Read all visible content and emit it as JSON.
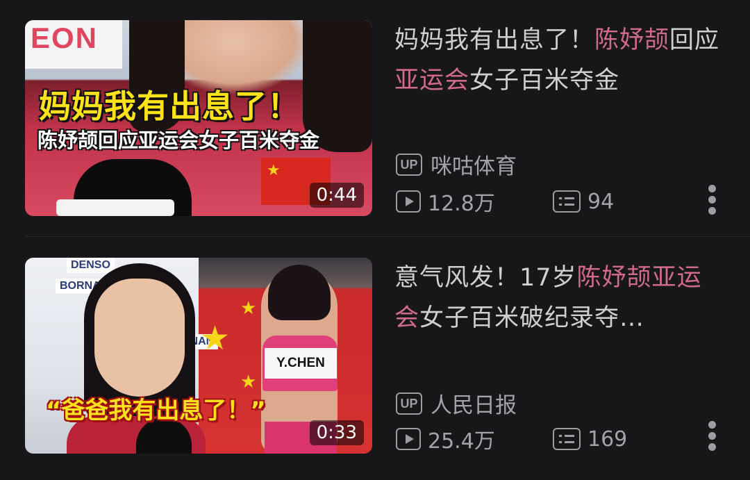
{
  "videos": [
    {
      "thumb_caption_main": "妈妈我有出息了！",
      "thumb_caption_sub": "陈妤颉回应亚运会女子百米夺金",
      "thumb_logo": "EON",
      "duration": "0:44",
      "title_parts": [
        {
          "text": "妈妈我有出息了！",
          "highlight": false
        },
        {
          "text": "陈妤颉",
          "highlight": true
        },
        {
          "text": "回应",
          "highlight": false
        },
        {
          "text": "亚运会",
          "highlight": true
        },
        {
          "text": "女子百米夺金",
          "highlight": false
        }
      ],
      "up_badge": "UP",
      "uploader": "咪咕体育",
      "views": "12.8万",
      "comments": "94"
    },
    {
      "thumb_quote": "“爸爸我有出息了！”",
      "thumb_bib": "Y.CHEN",
      "thumb_sponsor_1": "BORNAN",
      "thumb_sponsor_2": "DENSO",
      "duration": "0:33",
      "title_parts": [
        {
          "text": "意气风发！17岁",
          "highlight": false
        },
        {
          "text": "陈妤颉亚",
          "highlight": true
        },
        {
          "text": "运会",
          "highlight": true
        },
        {
          "text": "女子百米破纪录夺…",
          "highlight": false
        }
      ],
      "up_badge": "UP",
      "uploader": "人民日报",
      "views": "25.4万",
      "comments": "169"
    }
  ],
  "colors": {
    "background": "#17171a",
    "highlight": "#d06a8a",
    "text": "#cfcfd2",
    "meta": "#a3a3a8"
  },
  "icons": [
    "play-icon",
    "danmu-icon",
    "more-icon"
  ]
}
